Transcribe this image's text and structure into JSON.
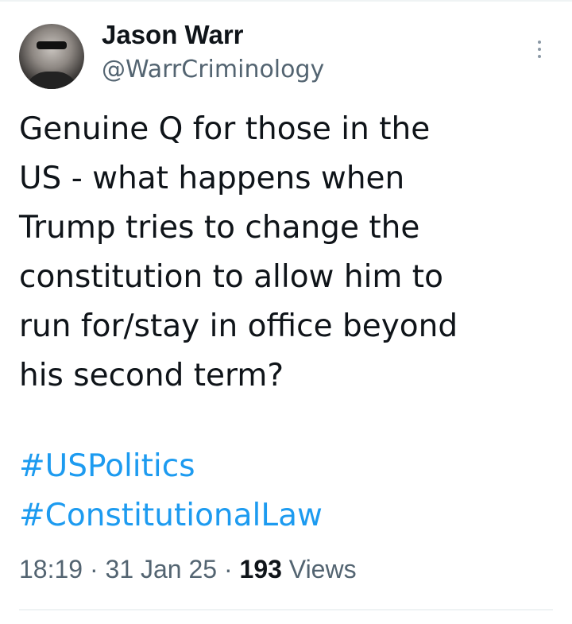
{
  "author": {
    "name": "Jason Warr",
    "handle": "@WarrCriminology",
    "avatar_icon": "profile-photo"
  },
  "menu": {
    "icon": "more-vertical-icon"
  },
  "tweet": {
    "lines": [
      "Genuine Q for those in the",
      "US - what happens when",
      "Trump tries to change the",
      "constitution to allow him to",
      "run for/stay in office beyond",
      "his second term?"
    ],
    "hashtags": [
      "#USPolitics",
      "#ConstitutionalLaw"
    ]
  },
  "meta": {
    "time": "18:19",
    "separator": " · ",
    "date": "31 Jan 25",
    "views_count": "193",
    "views_label": " Views"
  },
  "colors": {
    "text": "#0f1419",
    "secondary": "#536471",
    "link": "#1d9bf0",
    "divider": "#eff3f4"
  }
}
